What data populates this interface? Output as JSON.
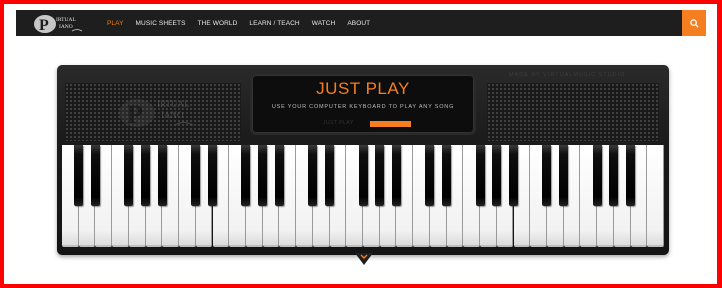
{
  "brand": {
    "logo_letter": "P",
    "logo_word1": "IRTUAL",
    "logo_word2": "IANO",
    "tagline": "MADE BY VIRTUALMUSIC STUDIO"
  },
  "nav": {
    "items": [
      {
        "label": "PLAY",
        "active": true
      },
      {
        "label": "MUSIC SHEETS",
        "active": false
      },
      {
        "label": "THE WORLD",
        "active": false
      },
      {
        "label": "LEARN / TEACH",
        "active": false
      },
      {
        "label": "WATCH",
        "active": false
      },
      {
        "label": "ABOUT",
        "active": false
      }
    ],
    "search_icon": "search-icon"
  },
  "display": {
    "title": "JUST PLAY",
    "subtitle": "USE YOUR COMPUTER KEYBOARD TO PLAY ANY SONG",
    "mode_label": "JUST PLAY"
  },
  "keyboard": {
    "white_keys": 36,
    "black_key_pattern": [
      1,
      1,
      0,
      1,
      1,
      1,
      0
    ]
  },
  "colors": {
    "accent": "#f57e20",
    "nav_bg": "#1e1e1e",
    "frame": "#ff0000"
  }
}
